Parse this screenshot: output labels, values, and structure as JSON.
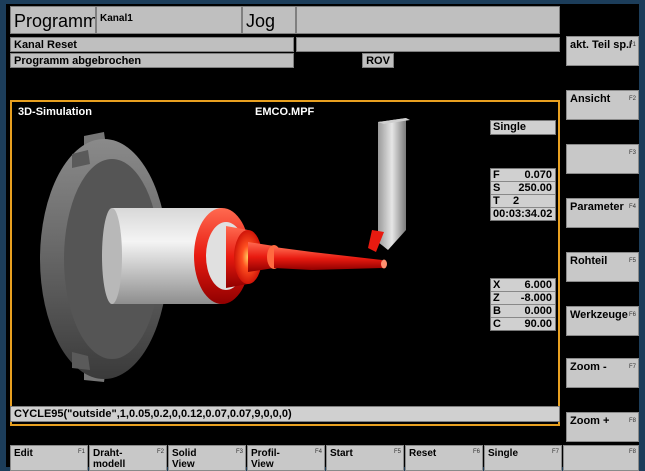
{
  "header": {
    "mode": "Programm",
    "channel": "Kanal1",
    "operation": "Jog",
    "status1": "Kanal Reset",
    "status2": "Programm abgebrochen",
    "rov": "ROV"
  },
  "sim": {
    "title": "3D-Simulation",
    "file": "EMCO.MPF",
    "mode": "Single",
    "params": [
      {
        "label": "F",
        "value": "0.070"
      },
      {
        "label": "S",
        "value": "250.00"
      },
      {
        "label": "T",
        "value": "2"
      },
      {
        "label": "",
        "value": "00:03:34.02"
      }
    ],
    "axes": [
      {
        "label": "X",
        "value": "6.000"
      },
      {
        "label": "Z",
        "value": "-8.000"
      },
      {
        "label": "B",
        "value": "0.000"
      },
      {
        "label": "C",
        "value": "90.00"
      }
    ],
    "cycle": "CYCLE95(\"outside\",1,0.05,0.2,0,0.12,0.07,0.07,9,0,0,0)"
  },
  "vsoftkeys": [
    {
      "label": "akt. Teil sp./",
      "fkey": "F1"
    },
    {
      "label": "Ansicht",
      "fkey": "F2"
    },
    {
      "label": "",
      "fkey": "F3"
    },
    {
      "label": "Parameter",
      "fkey": "F4"
    },
    {
      "label": "Rohteil",
      "fkey": "F5"
    },
    {
      "label": "Werkzeuge",
      "fkey": "F6"
    },
    {
      "label": "Zoom -",
      "fkey": "F7"
    },
    {
      "label": "Zoom +",
      "fkey": "F8"
    }
  ],
  "hsoftkeys": [
    {
      "label": "Edit",
      "fkey": "F1"
    },
    {
      "label": "Draht-modell",
      "fkey": "F2"
    },
    {
      "label": "Solid View",
      "fkey": "F3"
    },
    {
      "label": "Profil-View",
      "fkey": "F4"
    },
    {
      "label": "Start",
      "fkey": "F5"
    },
    {
      "label": "Reset",
      "fkey": "F6"
    },
    {
      "label": "Single",
      "fkey": "F7"
    },
    {
      "label": "",
      "fkey": "F8"
    }
  ],
  "colors": {
    "frame_border": "#e8a020",
    "workpiece_cut": "#e81a10",
    "background": "#000000"
  }
}
